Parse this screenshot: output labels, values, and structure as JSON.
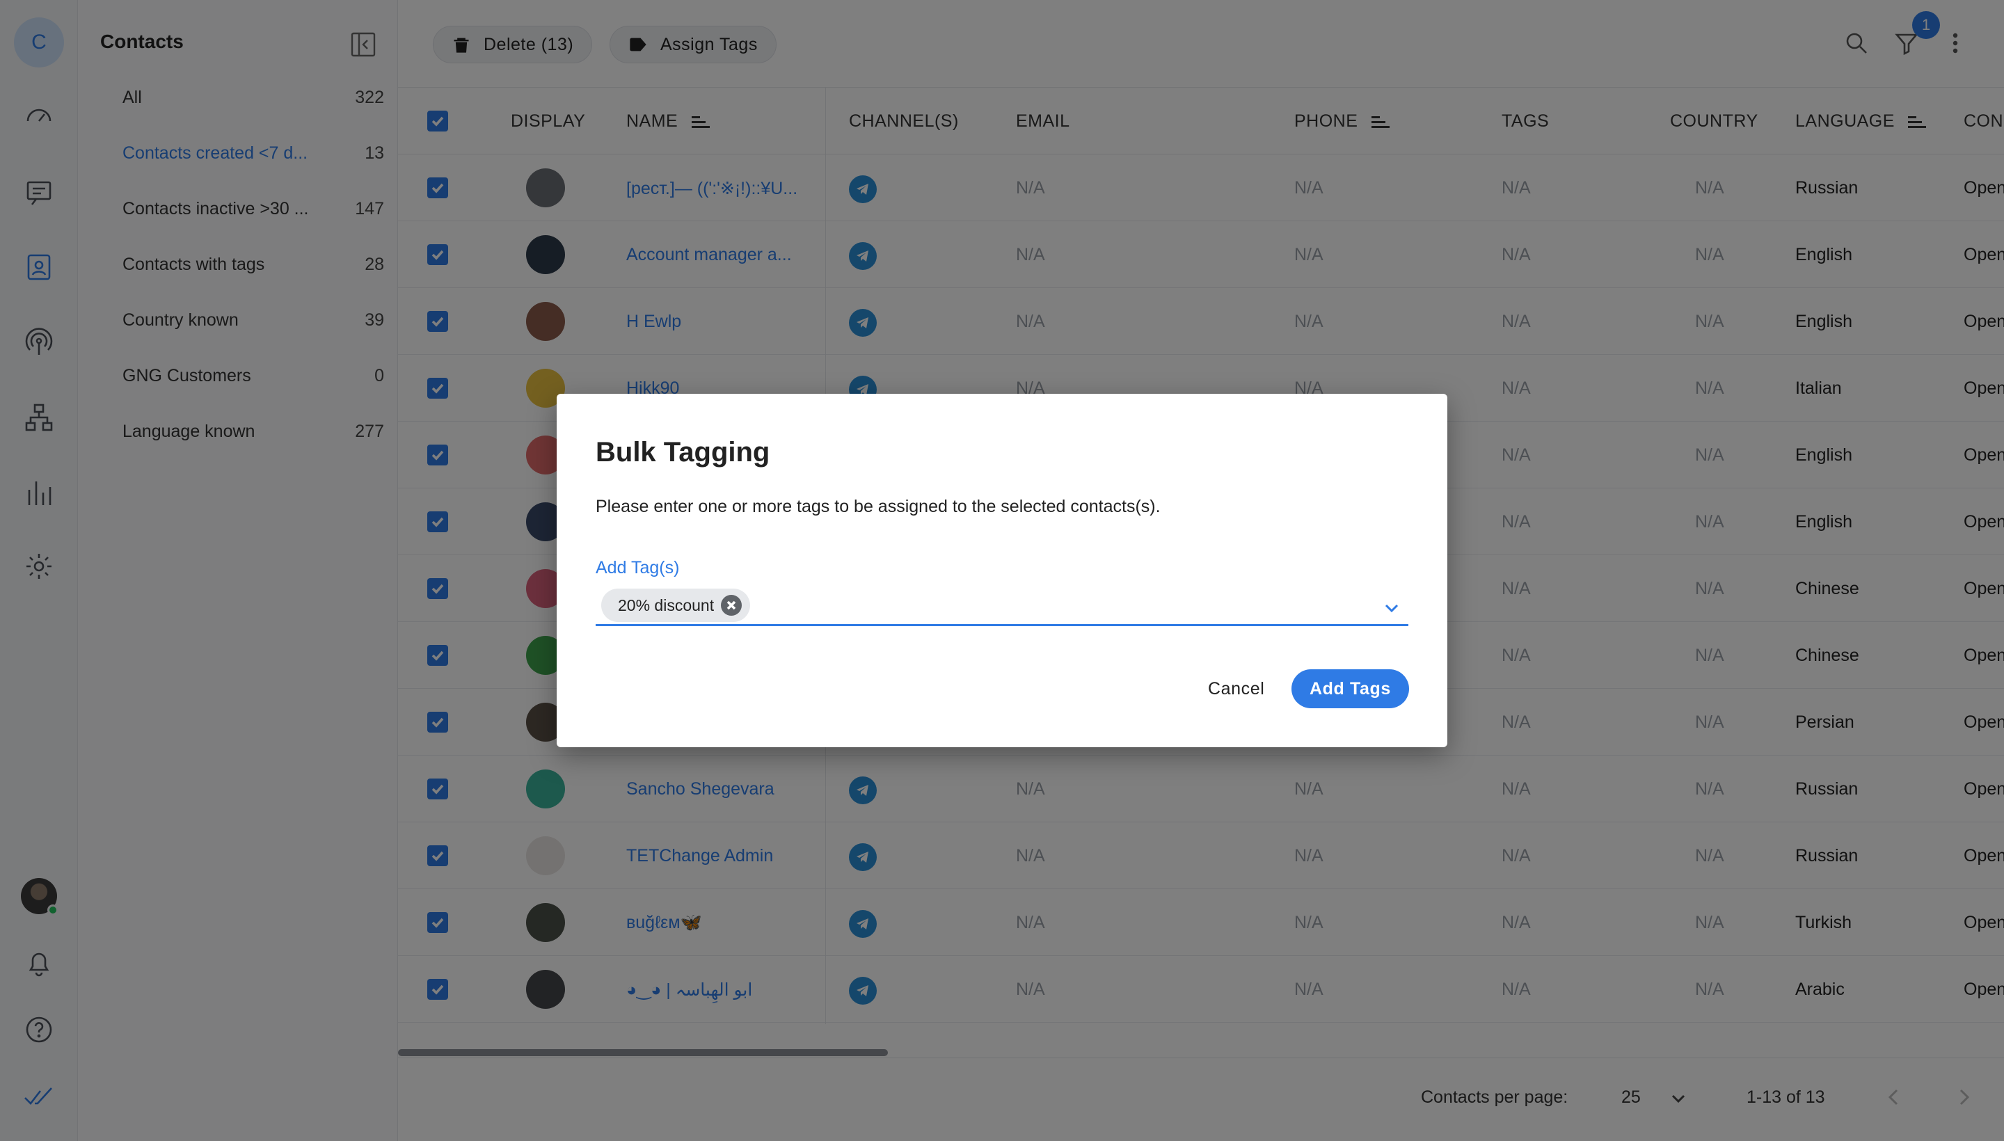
{
  "rail": {
    "account_initial": "C"
  },
  "sidebar": {
    "title": "Contacts",
    "items": [
      {
        "label": "All",
        "count": "322"
      },
      {
        "label": "Contacts created <7 d...",
        "count": "13"
      },
      {
        "label": "Contacts inactive >30 ...",
        "count": "147"
      },
      {
        "label": "Contacts with tags",
        "count": "28"
      },
      {
        "label": "Country known",
        "count": "39"
      },
      {
        "label": "GNG Customers",
        "count": "0"
      },
      {
        "label": "Language known",
        "count": "277"
      }
    ]
  },
  "toolbar": {
    "delete_label": "Delete (13)",
    "assign_label": "Assign Tags",
    "filter_badge": "1"
  },
  "table": {
    "headers": [
      "DISPLAY",
      "NAME",
      "CHANNEL(S)",
      "EMAIL",
      "PHONE",
      "TAGS",
      "COUNTRY",
      "LANGUAGE",
      "CON"
    ],
    "na": "N/A",
    "rows": [
      {
        "name": "[рест.]— ((':'※¡!)::¥U...",
        "language": "Russian",
        "status": "Open",
        "avatar_color": "#6b6f75"
      },
      {
        "name": "Account manager a...",
        "language": "English",
        "status": "Open",
        "avatar_color": "#2d3a4a"
      },
      {
        "name": "H Ewlp",
        "language": "English",
        "status": "Open",
        "avatar_color": "#8a5a4a"
      },
      {
        "name": "Hikk90",
        "language": "Italian",
        "status": "Open",
        "avatar_color": "#e8c040"
      },
      {
        "name": "",
        "language": "English",
        "status": "Open",
        "avatar_color": "#e06a6a"
      },
      {
        "name": "",
        "language": "English",
        "status": "Open",
        "avatar_color": "#3a4a6a"
      },
      {
        "name": "",
        "language": "Chinese",
        "status": "Open",
        "avatar_color": "#d9607a"
      },
      {
        "name": "",
        "language": "Chinese",
        "status": "Open",
        "avatar_color": "#3fa34d"
      },
      {
        "name": "",
        "language": "Persian",
        "status": "Open",
        "avatar_color": "#5a5046"
      },
      {
        "name": "Sancho Shegevara",
        "language": "Russian",
        "status": "Open",
        "avatar_color": "#3ab39a"
      },
      {
        "name": "TETChange Admin",
        "language": "Russian",
        "status": "Open",
        "avatar_color": "#e9e5e2"
      },
      {
        "name": "вuğℓεм🦋",
        "language": "Turkish",
        "status": "Open",
        "avatar_color": "#4a5048"
      },
      {
        "name": "◕‿◕ | ابو الهِباسہ",
        "language": "Arabic",
        "status": "Open",
        "avatar_color": "#45474b"
      }
    ]
  },
  "footer": {
    "per_page_label": "Contacts per page:",
    "per_page_value": "25",
    "range": "1-13 of 13"
  },
  "dialog": {
    "title": "Bulk Tagging",
    "description": "Please enter one or more tags to be assigned to the selected contacts(s).",
    "field_label": "Add Tag(s)",
    "chips": [
      "20% discount"
    ],
    "cancel_label": "Cancel",
    "submit_label": "Add Tags"
  },
  "colors": {
    "accent": "#2f7be5",
    "overlay": "rgba(0,0,0,0.5)"
  }
}
